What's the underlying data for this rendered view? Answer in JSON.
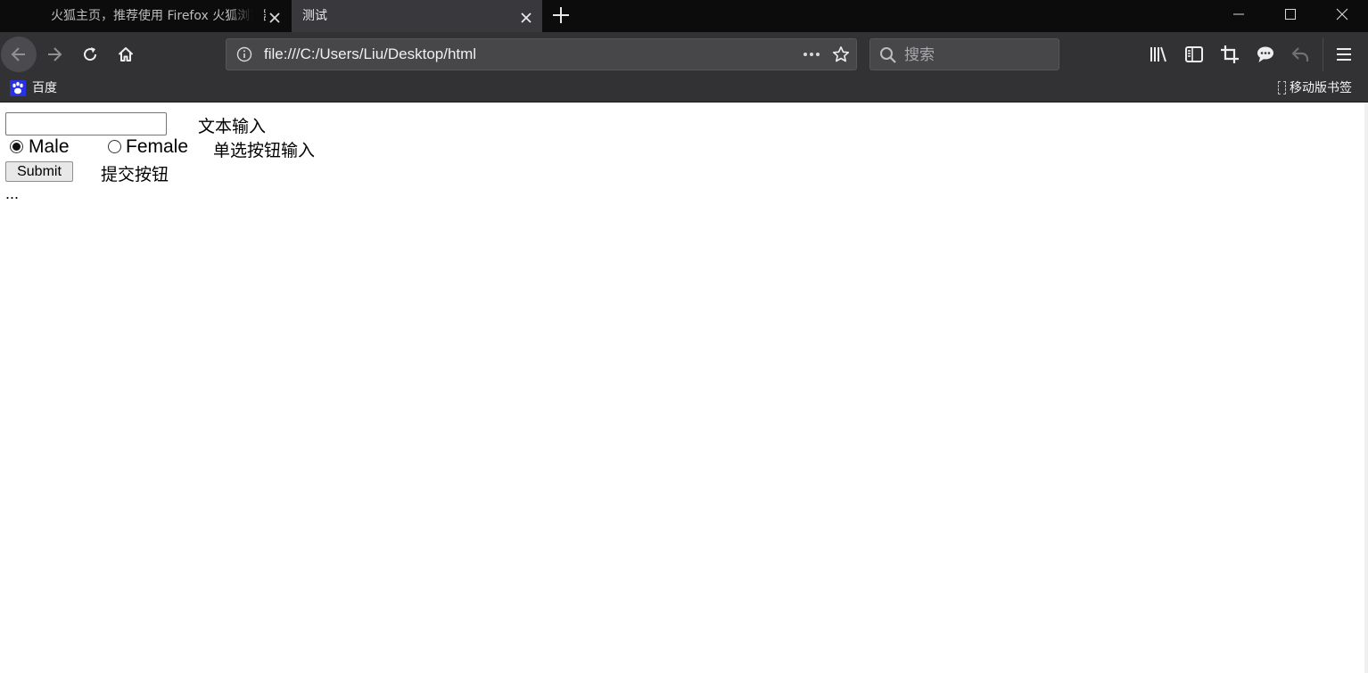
{
  "browser": {
    "tabs": [
      {
        "title": "火狐主页，推荐使用 Firefox 火狐浏览器",
        "active": false
      },
      {
        "title": "测试",
        "active": true
      }
    ],
    "url": "file:///C:/Users/Liu/Desktop/html",
    "search_placeholder": "搜索",
    "bookmarks": [
      {
        "label": "百度",
        "icon": "baidu-paw-icon"
      },
      {
        "label": "移动版书签",
        "icon": "mobile-bookmarks-icon"
      }
    ],
    "colors": {
      "tabstrip": "#0c0c0d",
      "toolbar": "#323234",
      "active_tab": "#38383d",
      "urlbar": "#474749",
      "baidu_blue": "#2932e1"
    }
  },
  "page": {
    "text_input": {
      "value": "",
      "note": "文本输入"
    },
    "radio_group": {
      "options": [
        {
          "label": "Male",
          "checked": true
        },
        {
          "label": "Female",
          "checked": false
        }
      ],
      "note": "单选按钮输入"
    },
    "submit": {
      "label": "Submit",
      "note": "提交按钮"
    },
    "ellipsis": "..."
  }
}
